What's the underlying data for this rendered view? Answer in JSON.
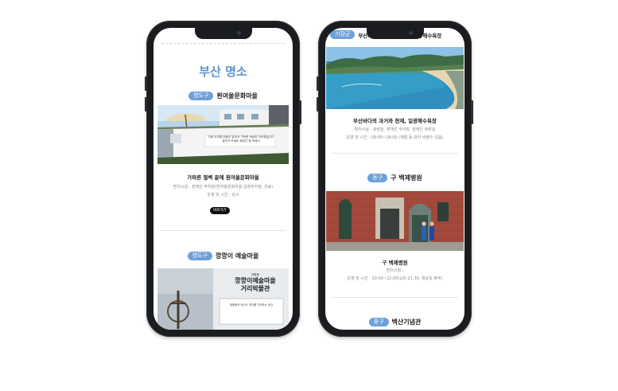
{
  "left_phone": {
    "page_title": "부산 명소",
    "spots": [
      {
        "region": "영도구",
        "name": "흰여울문화마을",
        "photo_text_1": "이제 사이에 마음이 닿아서 가득한 세상이 이어졌습니다",
        "photo_text_2": "걸어가 보세요 휘감긴 빛 속에서",
        "caption": "가파른 절벽 끝에 흰여울문화마을",
        "info_1": "편의시설 : 장애인 주차장(흰여울문화마을 공영주차장, 유료)",
        "info_2": "운영 및 시간 : 상시",
        "more": "바로가기"
      },
      {
        "region": "영도구",
        "name": "깡깡이 예술마을",
        "sign_small": "대평동",
        "sign_1": "깡깡이예술마을",
        "sign_2": "거리박물관",
        "plaque": "대평동의 조선소 역사를 기억하는 공간"
      }
    ]
  },
  "right_phone": {
    "top_region": "기장군",
    "top_name": "부산바다의 과거와 현재, 일광해수욕장",
    "spots": [
      {
        "caption": "부산바다의 과거와 현재, 일광해수욕장",
        "info_1": "편의시설 : 화장실, 장애인 주차장, 장애인 화장실",
        "info_2": "운영 및 시간 : 09:00~18:00 (계절 등 따라 바뀔수 있음)"
      },
      {
        "region": "동구",
        "name": "구 백제병원",
        "caption": "구 백제병원",
        "info_1": "편의시설 :",
        "info_2": "운영 및 시간 : 10:00~22:00(L/O 21:30, 월요일 휴무)"
      },
      {
        "region": "중구",
        "name": "백산기념관"
      }
    ]
  }
}
